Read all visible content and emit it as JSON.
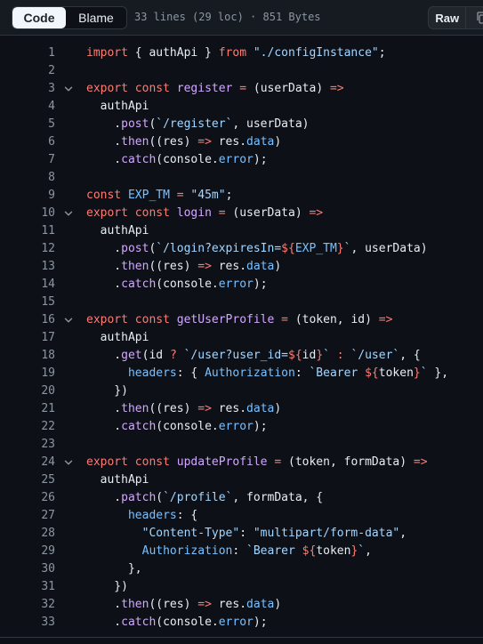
{
  "toolbar": {
    "code_label": "Code",
    "blame_label": "Blame",
    "file_info": "33 lines (29 loc) · 851 Bytes",
    "raw_label": "Raw"
  },
  "lines": [
    {
      "n": "1",
      "fold": false,
      "t": [
        [
          "k",
          "import"
        ],
        [
          "p",
          " { authApi } "
        ],
        [
          "k",
          "from"
        ],
        [
          "p",
          " "
        ],
        [
          "s",
          "\"./configInstance\""
        ],
        [
          "p",
          ";"
        ]
      ]
    },
    {
      "n": "2",
      "fold": false,
      "t": []
    },
    {
      "n": "3",
      "fold": true,
      "t": [
        [
          "k",
          "export"
        ],
        [
          "p",
          " "
        ],
        [
          "k",
          "const"
        ],
        [
          "p",
          " "
        ],
        [
          "f",
          "register"
        ],
        [
          "p",
          " "
        ],
        [
          "k",
          "="
        ],
        [
          "p",
          " (userData) "
        ],
        [
          "k",
          "=>"
        ]
      ]
    },
    {
      "n": "4",
      "fold": false,
      "t": [
        [
          "p",
          "  authApi"
        ]
      ]
    },
    {
      "n": "5",
      "fold": false,
      "t": [
        [
          "p",
          "    ."
        ],
        [
          "f",
          "post"
        ],
        [
          "p",
          "("
        ],
        [
          "s",
          "`/register`"
        ],
        [
          "p",
          ", userData)"
        ]
      ]
    },
    {
      "n": "6",
      "fold": false,
      "t": [
        [
          "p",
          "    ."
        ],
        [
          "f",
          "then"
        ],
        [
          "p",
          "((res) "
        ],
        [
          "k",
          "=>"
        ],
        [
          "p",
          " res."
        ],
        [
          "c",
          "data"
        ],
        [
          "p",
          ")"
        ]
      ]
    },
    {
      "n": "7",
      "fold": false,
      "t": [
        [
          "p",
          "    ."
        ],
        [
          "f",
          "catch"
        ],
        [
          "p",
          "(console."
        ],
        [
          "c",
          "error"
        ],
        [
          "p",
          ");"
        ]
      ]
    },
    {
      "n": "8",
      "fold": false,
      "t": []
    },
    {
      "n": "9",
      "fold": false,
      "t": [
        [
          "k",
          "const"
        ],
        [
          "p",
          " "
        ],
        [
          "c",
          "EXP_TM"
        ],
        [
          "p",
          " "
        ],
        [
          "k",
          "="
        ],
        [
          "p",
          " "
        ],
        [
          "s",
          "\"45m\""
        ],
        [
          "p",
          ";"
        ]
      ]
    },
    {
      "n": "10",
      "fold": true,
      "t": [
        [
          "k",
          "export"
        ],
        [
          "p",
          " "
        ],
        [
          "k",
          "const"
        ],
        [
          "p",
          " "
        ],
        [
          "f",
          "login"
        ],
        [
          "p",
          " "
        ],
        [
          "k",
          "="
        ],
        [
          "p",
          " (userData) "
        ],
        [
          "k",
          "=>"
        ]
      ]
    },
    {
      "n": "11",
      "fold": false,
      "t": [
        [
          "p",
          "  authApi"
        ]
      ]
    },
    {
      "n": "12",
      "fold": false,
      "t": [
        [
          "p",
          "    ."
        ],
        [
          "f",
          "post"
        ],
        [
          "p",
          "("
        ],
        [
          "s",
          "`/login?expiresIn="
        ],
        [
          "k",
          "${"
        ],
        [
          "c",
          "EXP_TM"
        ],
        [
          "k",
          "}"
        ],
        [
          "s",
          "`"
        ],
        [
          "p",
          ", userData)"
        ]
      ]
    },
    {
      "n": "13",
      "fold": false,
      "t": [
        [
          "p",
          "    ."
        ],
        [
          "f",
          "then"
        ],
        [
          "p",
          "((res) "
        ],
        [
          "k",
          "=>"
        ],
        [
          "p",
          " res."
        ],
        [
          "c",
          "data"
        ],
        [
          "p",
          ")"
        ]
      ]
    },
    {
      "n": "14",
      "fold": false,
      "t": [
        [
          "p",
          "    ."
        ],
        [
          "f",
          "catch"
        ],
        [
          "p",
          "(console."
        ],
        [
          "c",
          "error"
        ],
        [
          "p",
          ");"
        ]
      ]
    },
    {
      "n": "15",
      "fold": false,
      "t": []
    },
    {
      "n": "16",
      "fold": true,
      "t": [
        [
          "k",
          "export"
        ],
        [
          "p",
          " "
        ],
        [
          "k",
          "const"
        ],
        [
          "p",
          " "
        ],
        [
          "f",
          "getUserProfile"
        ],
        [
          "p",
          " "
        ],
        [
          "k",
          "="
        ],
        [
          "p",
          " (token, id) "
        ],
        [
          "k",
          "=>"
        ]
      ]
    },
    {
      "n": "17",
      "fold": false,
      "t": [
        [
          "p",
          "  authApi"
        ]
      ]
    },
    {
      "n": "18",
      "fold": false,
      "t": [
        [
          "p",
          "    ."
        ],
        [
          "f",
          "get"
        ],
        [
          "p",
          "(id "
        ],
        [
          "k",
          "?"
        ],
        [
          "p",
          " "
        ],
        [
          "s",
          "`/user?user_id="
        ],
        [
          "k",
          "${"
        ],
        [
          "p",
          "id"
        ],
        [
          "k",
          "}"
        ],
        [
          "s",
          "`"
        ],
        [
          "p",
          " "
        ],
        [
          "k",
          ":"
        ],
        [
          "p",
          " "
        ],
        [
          "s",
          "`/user`"
        ],
        [
          "p",
          ", {"
        ]
      ]
    },
    {
      "n": "19",
      "fold": false,
      "t": [
        [
          "p",
          "      "
        ],
        [
          "c",
          "headers"
        ],
        [
          "p",
          ": { "
        ],
        [
          "c",
          "Authorization"
        ],
        [
          "p",
          ": "
        ],
        [
          "s",
          "`Bearer "
        ],
        [
          "k",
          "${"
        ],
        [
          "p",
          "token"
        ],
        [
          "k",
          "}"
        ],
        [
          "s",
          "`"
        ],
        [
          "p",
          " },"
        ]
      ]
    },
    {
      "n": "20",
      "fold": false,
      "t": [
        [
          "p",
          "    })"
        ]
      ]
    },
    {
      "n": "21",
      "fold": false,
      "t": [
        [
          "p",
          "    ."
        ],
        [
          "f",
          "then"
        ],
        [
          "p",
          "((res) "
        ],
        [
          "k",
          "=>"
        ],
        [
          "p",
          " res."
        ],
        [
          "c",
          "data"
        ],
        [
          "p",
          ")"
        ]
      ]
    },
    {
      "n": "22",
      "fold": false,
      "t": [
        [
          "p",
          "    ."
        ],
        [
          "f",
          "catch"
        ],
        [
          "p",
          "(console."
        ],
        [
          "c",
          "error"
        ],
        [
          "p",
          ");"
        ]
      ]
    },
    {
      "n": "23",
      "fold": false,
      "t": []
    },
    {
      "n": "24",
      "fold": true,
      "t": [
        [
          "k",
          "export"
        ],
        [
          "p",
          " "
        ],
        [
          "k",
          "const"
        ],
        [
          "p",
          " "
        ],
        [
          "f",
          "updateProfile"
        ],
        [
          "p",
          " "
        ],
        [
          "k",
          "="
        ],
        [
          "p",
          " (token, formData) "
        ],
        [
          "k",
          "=>"
        ]
      ]
    },
    {
      "n": "25",
      "fold": false,
      "t": [
        [
          "p",
          "  authApi"
        ]
      ]
    },
    {
      "n": "26",
      "fold": false,
      "t": [
        [
          "p",
          "    ."
        ],
        [
          "f",
          "patch"
        ],
        [
          "p",
          "("
        ],
        [
          "s",
          "`/profile`"
        ],
        [
          "p",
          ", formData, {"
        ]
      ]
    },
    {
      "n": "27",
      "fold": false,
      "t": [
        [
          "p",
          "      "
        ],
        [
          "c",
          "headers"
        ],
        [
          "p",
          ": {"
        ]
      ]
    },
    {
      "n": "28",
      "fold": false,
      "t": [
        [
          "p",
          "        "
        ],
        [
          "s",
          "\"Content-Type\""
        ],
        [
          "p",
          ": "
        ],
        [
          "s",
          "\"multipart/form-data\""
        ],
        [
          "p",
          ","
        ]
      ]
    },
    {
      "n": "29",
      "fold": false,
      "t": [
        [
          "p",
          "        "
        ],
        [
          "c",
          "Authorization"
        ],
        [
          "p",
          ": "
        ],
        [
          "s",
          "`Bearer "
        ],
        [
          "k",
          "${"
        ],
        [
          "p",
          "token"
        ],
        [
          "k",
          "}"
        ],
        [
          "s",
          "`"
        ],
        [
          "p",
          ","
        ]
      ]
    },
    {
      "n": "30",
      "fold": false,
      "t": [
        [
          "p",
          "      },"
        ]
      ]
    },
    {
      "n": "31",
      "fold": false,
      "t": [
        [
          "p",
          "    })"
        ]
      ]
    },
    {
      "n": "32",
      "fold": false,
      "t": [
        [
          "p",
          "    ."
        ],
        [
          "f",
          "then"
        ],
        [
          "p",
          "((res) "
        ],
        [
          "k",
          "=>"
        ],
        [
          "p",
          " res."
        ],
        [
          "c",
          "data"
        ],
        [
          "p",
          ")"
        ]
      ]
    },
    {
      "n": "33",
      "fold": false,
      "t": [
        [
          "p",
          "    ."
        ],
        [
          "f",
          "catch"
        ],
        [
          "p",
          "(console."
        ],
        [
          "c",
          "error"
        ],
        [
          "p",
          ");"
        ]
      ]
    }
  ],
  "icons": {
    "fold": "chevron-down-icon",
    "copy": "copy-icon"
  }
}
